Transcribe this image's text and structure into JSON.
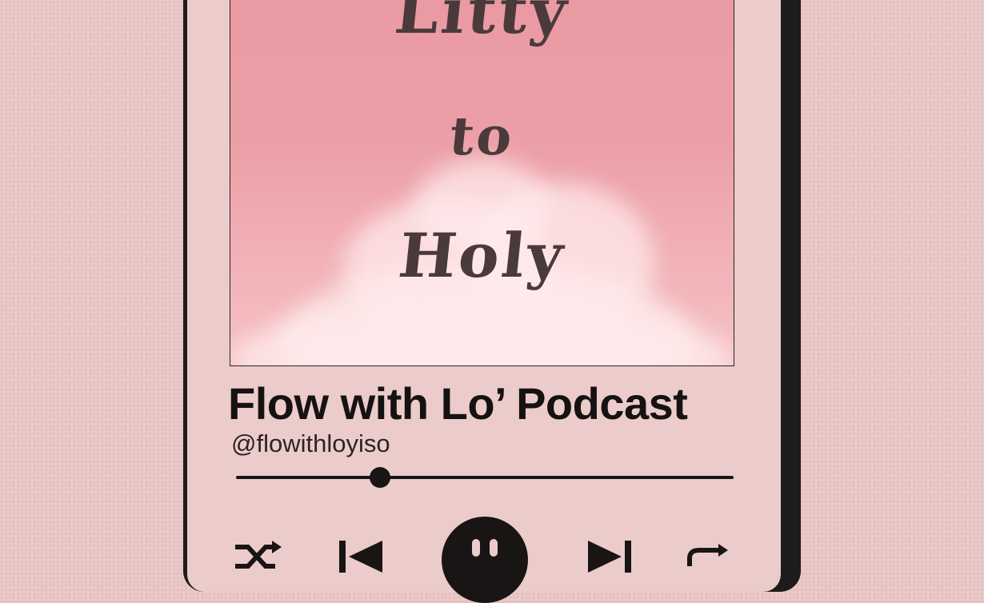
{
  "artwork": {
    "title_lines": [
      "Litty",
      "to",
      "Holy"
    ]
  },
  "track": {
    "title": "Flow with Lo’ Podcast",
    "artist": "@flowithloyiso"
  },
  "progress": {
    "fraction": 0.29
  },
  "controls": {
    "shuffle_icon": "shuffle-icon",
    "previous_icon": "skip-previous-icon",
    "play_pause_icon": "pause-icon",
    "next_icon": "skip-next-icon",
    "repeat_icon": "repeat-icon"
  },
  "colors": {
    "background": "#e9c7c6",
    "screen": "#ebcccb",
    "frame": "#1e1b1b",
    "artwork_sky": "#ea9aa2",
    "text": "#161212"
  }
}
